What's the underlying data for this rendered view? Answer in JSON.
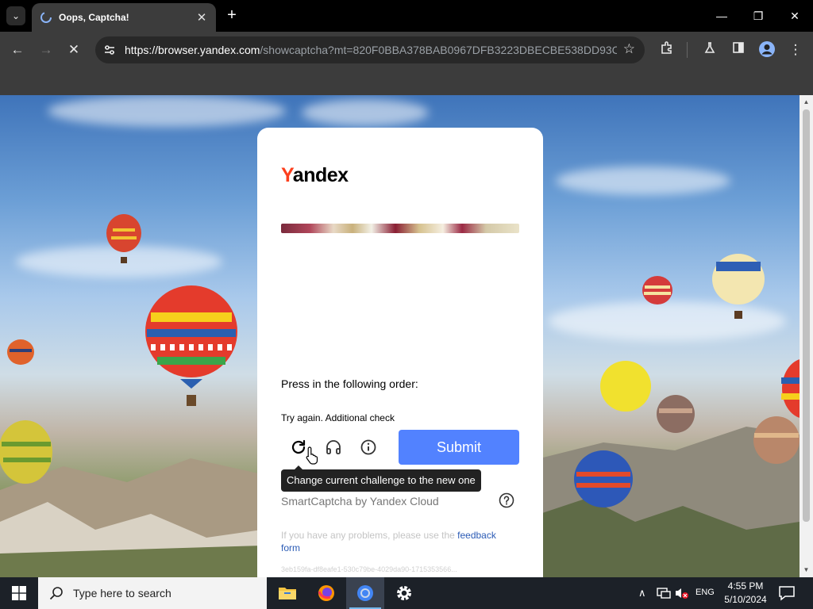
{
  "browser": {
    "tab": {
      "title": "Oops, Captcha!"
    },
    "url": {
      "host": "https://browser.yandex.com",
      "path": "/showcaptcha?mt=820F0BBA378BAB0967DFB3223DBECBE538DD93CB..."
    }
  },
  "captcha": {
    "logo": {
      "first": "Y",
      "rest": "andex"
    },
    "instruction": "Press in the following order:",
    "retry_message": "Try again. Additional check",
    "submit_label": "Submit",
    "tooltip": "Change current challenge to the new one",
    "brand": "SmartCaptcha by Yandex Cloud",
    "problems_text": "If you have any problems, please use the ",
    "feedback_link": "feedback form",
    "token": "3eb159fa-df8eafe1-530c79be-4029da90-1715353566..."
  },
  "taskbar": {
    "search_placeholder": "Type here to search",
    "language": "ENG",
    "time": "4:55 PM",
    "date": "5/10/2024"
  },
  "colors": {
    "accent": "#5282ff",
    "yandex_red": "#fc3f1d",
    "link": "#2b5bb5"
  }
}
